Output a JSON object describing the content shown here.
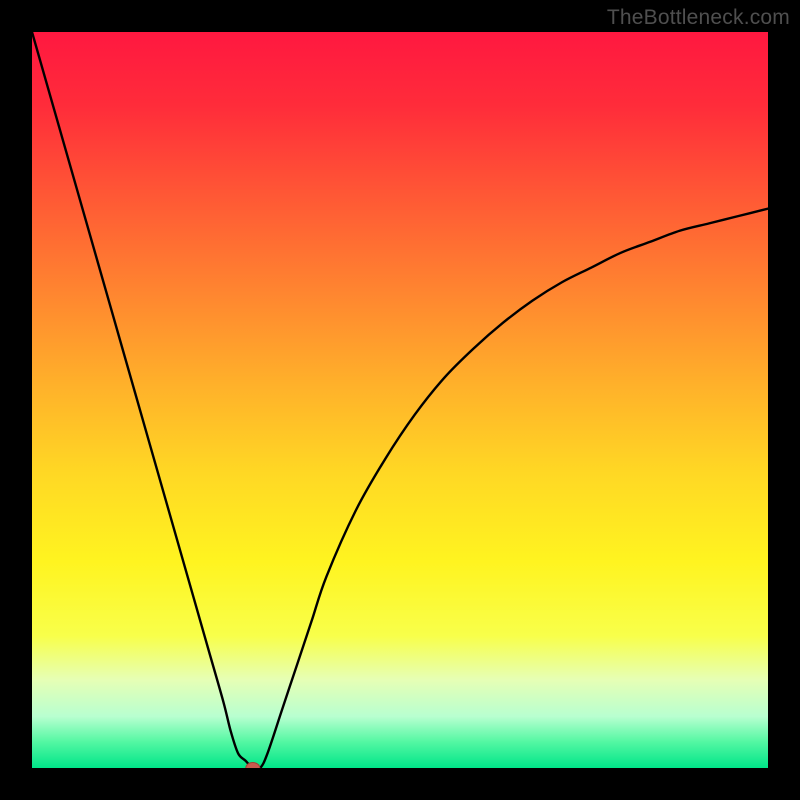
{
  "watermark": "TheBottleneck.com",
  "colors": {
    "frame": "#000000",
    "curve": "#000000",
    "dot_fill": "#c85b4f",
    "dot_stroke": "#a33f35",
    "gradient_stops": [
      {
        "offset": 0.0,
        "color": "#ff1840"
      },
      {
        "offset": 0.1,
        "color": "#ff2c3a"
      },
      {
        "offset": 0.22,
        "color": "#ff5735"
      },
      {
        "offset": 0.35,
        "color": "#ff8430"
      },
      {
        "offset": 0.48,
        "color": "#ffb12a"
      },
      {
        "offset": 0.6,
        "color": "#ffd824"
      },
      {
        "offset": 0.72,
        "color": "#fff420"
      },
      {
        "offset": 0.82,
        "color": "#f8ff4a"
      },
      {
        "offset": 0.88,
        "color": "#e6ffb5"
      },
      {
        "offset": 0.93,
        "color": "#b8ffd0"
      },
      {
        "offset": 0.965,
        "color": "#52f7a2"
      },
      {
        "offset": 1.0,
        "color": "#00e589"
      }
    ]
  },
  "chart_data": {
    "type": "line",
    "title": "",
    "xlabel": "",
    "ylabel": "",
    "xlim": [
      0,
      100
    ],
    "ylim": [
      0,
      100
    ],
    "series": [
      {
        "name": "bottleneck-curve",
        "x": [
          0,
          2,
          4,
          6,
          8,
          10,
          12,
          14,
          16,
          18,
          20,
          22,
          24,
          26,
          27,
          28,
          29,
          30,
          31,
          32,
          34,
          36,
          38,
          40,
          44,
          48,
          52,
          56,
          60,
          64,
          68,
          72,
          76,
          80,
          84,
          88,
          92,
          96,
          100
        ],
        "y": [
          100,
          93,
          86,
          79,
          72,
          65,
          58,
          51,
          44,
          37,
          30,
          23,
          16,
          9,
          5,
          2,
          1,
          0,
          0,
          2,
          8,
          14,
          20,
          26,
          35,
          42,
          48,
          53,
          57,
          60.5,
          63.5,
          66,
          68,
          70,
          71.5,
          73,
          74,
          75,
          76
        ]
      }
    ],
    "marker": {
      "x": 30,
      "y": 0
    }
  }
}
